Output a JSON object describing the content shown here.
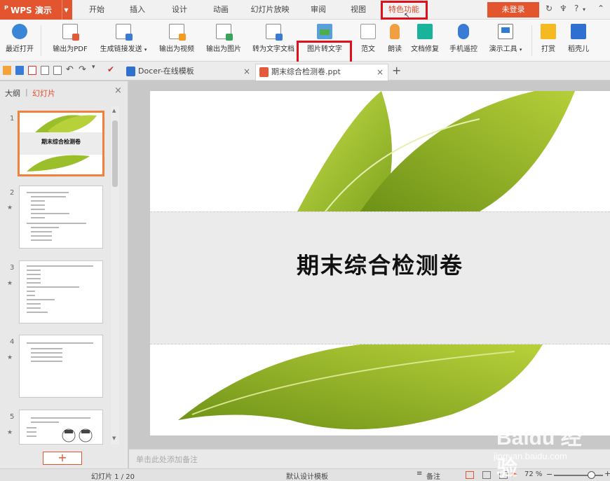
{
  "app": {
    "name": "WPS 演示"
  },
  "menu": {
    "tabs": [
      {
        "label": "开始"
      },
      {
        "label": "插入"
      },
      {
        "label": "设计"
      },
      {
        "label": "动画"
      },
      {
        "label": "幻灯片放映"
      },
      {
        "label": "审阅"
      },
      {
        "label": "视图"
      },
      {
        "label": "特色功能"
      }
    ],
    "active_tab": "特色功能",
    "login_label": "未登录",
    "help_label": "?"
  },
  "ribbon": {
    "items": [
      {
        "label": "最近打开",
        "icon": "cloud-icon"
      },
      {
        "label": "输出为PDF",
        "icon": "pdf-export-icon"
      },
      {
        "label": "生成链接发送",
        "icon": "link-share-icon"
      },
      {
        "label": "输出为视频",
        "icon": "video-export-icon"
      },
      {
        "label": "输出为图片",
        "icon": "image-export-icon"
      },
      {
        "label": "转为文字文档",
        "icon": "convert-doc-icon"
      },
      {
        "label": "图片转文字",
        "icon": "image-to-text-icon"
      },
      {
        "label": "范文",
        "icon": "template-doc-icon"
      },
      {
        "label": "朗读",
        "icon": "microphone-icon"
      },
      {
        "label": "文档修复",
        "icon": "document-repair-icon"
      },
      {
        "label": "手机遥控",
        "icon": "phone-remote-icon"
      },
      {
        "label": "演示工具",
        "icon": "presentation-tools-icon"
      },
      {
        "label": "打赏",
        "icon": "reward-icon"
      },
      {
        "label": "稻壳儿",
        "icon": "docer-icon"
      }
    ]
  },
  "doc_tabs": [
    {
      "label": "Docer-在线模板",
      "close": "×"
    },
    {
      "label": "期末综合检测卷.ppt",
      "close": "×"
    }
  ],
  "new_tab_label": "+",
  "panel": {
    "tab_outline": "大纲",
    "separator": "|",
    "tab_slides": "幻灯片",
    "close": "×",
    "slides": [
      {
        "num": "1",
        "title": "期末综合检测卷"
      },
      {
        "num": "2",
        "star": "★"
      },
      {
        "num": "3",
        "star": "★"
      },
      {
        "num": "4",
        "star": "★"
      },
      {
        "num": "5",
        "star": "★"
      }
    ],
    "add_label": "+"
  },
  "slide": {
    "title": "期末综合检测卷"
  },
  "notes": {
    "placeholder": "单击此处添加备注"
  },
  "status": {
    "slide_counter": "幻灯片 1 / 20",
    "template": "默认设计模板",
    "notes_label": "备注",
    "zoom": "72 %",
    "zoom_level_percent": 72
  },
  "watermark": {
    "brand": "Baidu 经验",
    "url": "jingyan.baidu.com"
  },
  "colors": {
    "accent": "#e2552e",
    "highlight_box": "#e0101a",
    "leaf_green": "#9bbf2a"
  }
}
